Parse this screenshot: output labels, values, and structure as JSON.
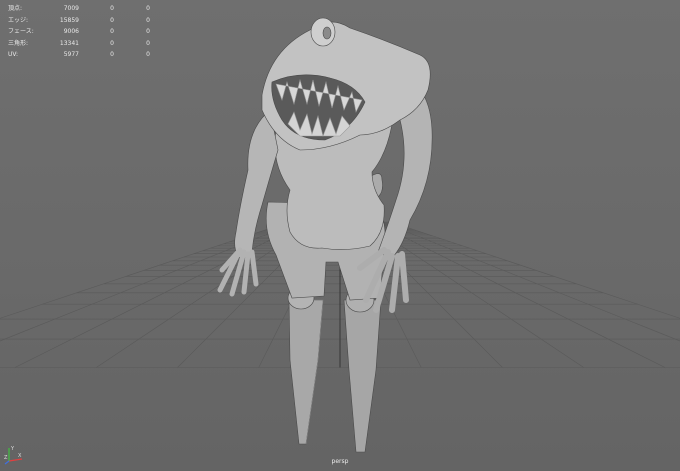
{
  "hud": {
    "rows": [
      {
        "label": "頂点:",
        "v1": "7009",
        "v2": "0",
        "v3": "0"
      },
      {
        "label": "エッジ:",
        "v1": "15859",
        "v2": "0",
        "v3": "0"
      },
      {
        "label": "フェース:",
        "v1": "9006",
        "v2": "0",
        "v3": "0"
      },
      {
        "label": "三角形:",
        "v1": "13341",
        "v2": "0",
        "v3": "0"
      },
      {
        "label": "UV:",
        "v1": "5977",
        "v2": "0",
        "v3": "0"
      }
    ]
  },
  "camera": {
    "name": "persp"
  },
  "axis": {
    "x_label": "X",
    "y_label": "Y",
    "z_label": "Z",
    "x_color": "#e04040",
    "y_color": "#40c040",
    "z_color": "#4070e0"
  },
  "grid": {
    "visible": true
  }
}
